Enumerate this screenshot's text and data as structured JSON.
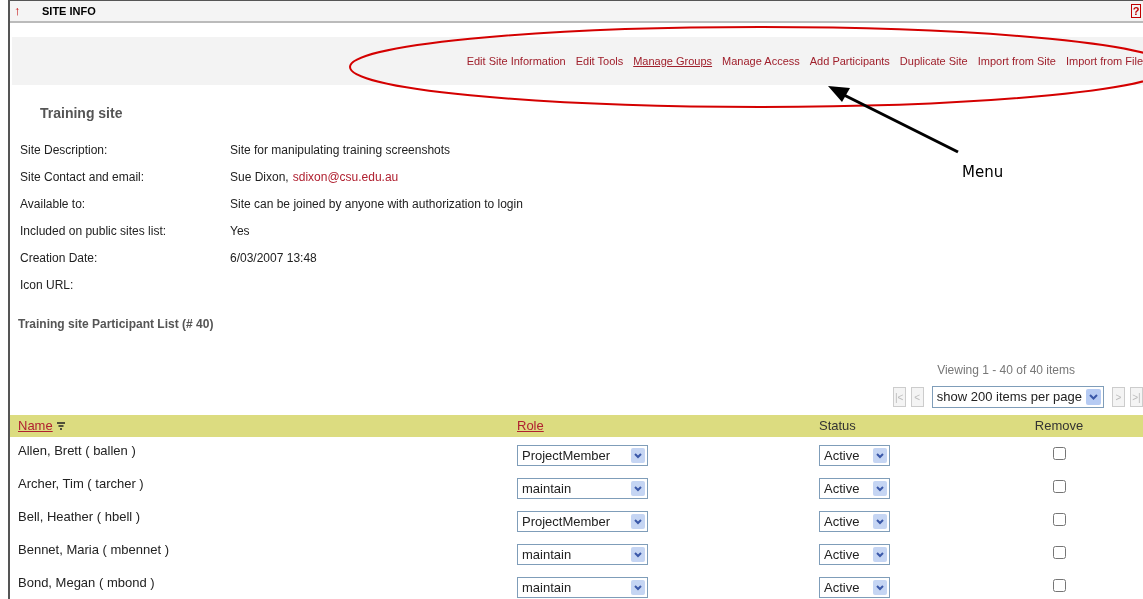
{
  "header": {
    "icon": "↑",
    "title": "SITE INFO",
    "help": "?"
  },
  "menu": [
    {
      "label": "Edit Site Information",
      "selected": false
    },
    {
      "label": "Edit Tools",
      "selected": false
    },
    {
      "label": "Manage Groups",
      "selected": true
    },
    {
      "label": "Manage Access",
      "selected": false
    },
    {
      "label": "Add Participants",
      "selected": false
    },
    {
      "label": "Duplicate Site",
      "selected": false
    },
    {
      "label": "Import from Site",
      "selected": false
    },
    {
      "label": "Import from File",
      "selected": false
    }
  ],
  "annotation": {
    "label": "Menu"
  },
  "site_title": "Training site",
  "info": [
    {
      "label": "Site Description:",
      "value": "Site for manipulating training screenshots"
    },
    {
      "label": "Site Contact and email:",
      "value": "Sue Dixon,",
      "link": "sdixon@csu.edu.au"
    },
    {
      "label": "Available to:",
      "value": "Site can be joined by anyone with authorization to login"
    },
    {
      "label": "Included on public sites list:",
      "value": "Yes"
    },
    {
      "label": "Creation Date:",
      "value": "6/03/2007 13:48"
    },
    {
      "label": "Icon URL:"
    }
  ],
  "participant_heading": "Training site Participant List (# 40)",
  "pager": {
    "viewing": "Viewing 1 - 40 of 40 items",
    "page_size": "show 200 items per page",
    "first": {
      "label": "|<",
      "disabled": true
    },
    "prev": {
      "label": "<",
      "disabled": true
    },
    "next": {
      "label": ">",
      "disabled": true
    },
    "last": {
      "label": ">|",
      "disabled": true
    }
  },
  "table": {
    "columns": [
      {
        "label": "Name",
        "link": true
      },
      {
        "label": "Role",
        "link": true
      },
      {
        "label": "Status",
        "link": false
      },
      {
        "label": "Remove",
        "link": false
      }
    ],
    "rows": [
      {
        "name": "Allen, Brett ( ballen )",
        "role": "ProjectMember",
        "status": "Active",
        "checked": false
      },
      {
        "name": "Archer, Tim ( tarcher )",
        "role": "maintain",
        "status": "Active",
        "checked": false
      },
      {
        "name": "Bell, Heather ( hbell )",
        "role": "ProjectMember",
        "status": "Active",
        "checked": false
      },
      {
        "name": "Bennet, Maria ( mbennet )",
        "role": "maintain",
        "status": "Active",
        "checked": false
      },
      {
        "name": "Bond, Megan ( mbond )",
        "role": "maintain",
        "status": "Active",
        "checked": false
      }
    ]
  }
}
